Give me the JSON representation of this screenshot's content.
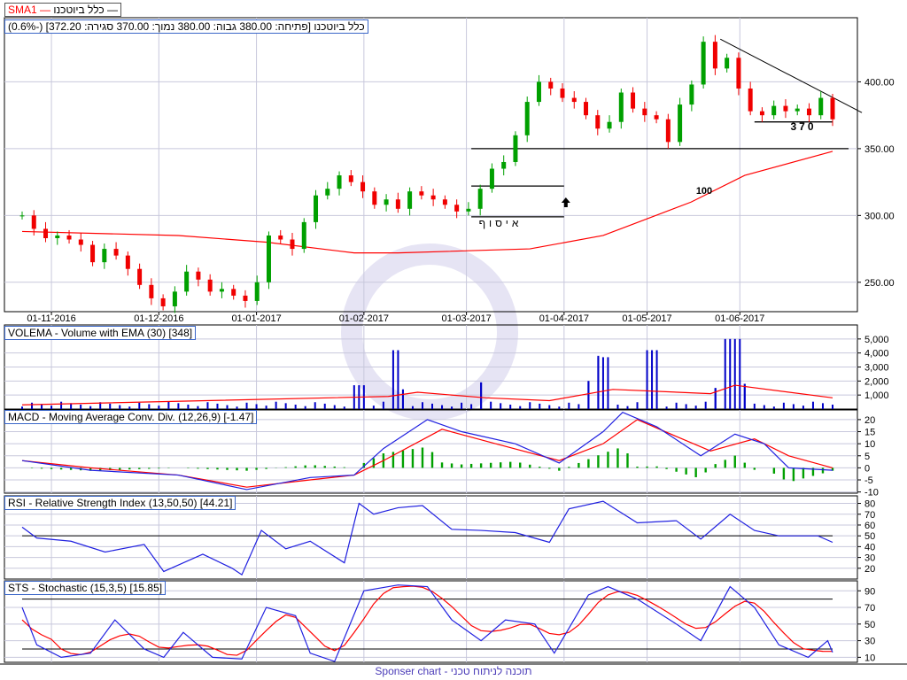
{
  "top_legend": {
    "series": "כלל ביוטכנו",
    "sma": "SMA1",
    "sma_color": "#ff0000"
  },
  "price_info": "כלל ביוטכנו [פתיחה: 380.00  גבוה: 380.00  נמוך: 370.00  סגירה: 372.20] (-0.6%)",
  "footer": "Sponser chart - תוכנה לניתוח טכני",
  "annotations": {
    "accumulation": "איסוף",
    "support": "370",
    "sma_label": "100"
  },
  "chart_data": [
    {
      "type": "candlestick",
      "title": "כלל ביוטכנו",
      "x_tick_labels": [
        "01-11-2016",
        "01-12-2016",
        "01-01-2017",
        "01-02-2017",
        "01-03-2017",
        "01-04-2017",
        "01-05-2017",
        "01-06-2017"
      ],
      "x_tick_days": [
        6,
        28,
        48,
        70,
        91,
        111,
        128,
        147
      ],
      "y_ticks": [
        250,
        300,
        350,
        400
      ],
      "y_tick_labels": [
        "250.00",
        "300.00",
        "350.00",
        "400.00"
      ],
      "ylim": [
        228,
        448
      ],
      "day_range": [
        0,
        166
      ],
      "closes": [
        300,
        290,
        283,
        285,
        282,
        278,
        265,
        275,
        270,
        260,
        248,
        238,
        232,
        243,
        258,
        252,
        243,
        245,
        240,
        236,
        250,
        285,
        282,
        275,
        295,
        315,
        320,
        330,
        325,
        318,
        308,
        312,
        305,
        318,
        315,
        312,
        308,
        303,
        305,
        320,
        335,
        340,
        360,
        385,
        400,
        395,
        388,
        385,
        375,
        365,
        370,
        392,
        380,
        375,
        372,
        355,
        383,
        398,
        430,
        410,
        418,
        395,
        378,
        375,
        382,
        378,
        380,
        375,
        388,
        372
      ],
      "sma": {
        "name": "SMA1 (100)",
        "color": "#ff0000",
        "points": [
          [
            0,
            288
          ],
          [
            32,
            285
          ],
          [
            50,
            280
          ],
          [
            68,
            272
          ],
          [
            77,
            272
          ],
          [
            104,
            275
          ],
          [
            119,
            285
          ],
          [
            137,
            310
          ],
          [
            148,
            330
          ],
          [
            166,
            348
          ]
        ]
      },
      "horizontal_lines": [
        {
          "value": 350,
          "from": 92,
          "to": 170
        },
        {
          "value": 322,
          "from": 92,
          "to": 111
        },
        {
          "value": 299,
          "from": 92,
          "to": 111
        },
        {
          "value": 370,
          "from": 150,
          "to": 166
        }
      ],
      "trendline": [
        [
          143,
          432
        ],
        [
          172,
          377
        ]
      ]
    },
    {
      "type": "bar",
      "title": "VOLEMA - Volume with EMA (30) [348]",
      "y_ticks": [
        1000,
        2000,
        3000,
        4000,
        5000
      ],
      "y_tick_labels": [
        "1,000",
        "2,000",
        "3,000",
        "4,000",
        "5,000"
      ],
      "ylim": [
        0,
        6000
      ],
      "spikes": [
        [
          69,
          1700
        ],
        [
          77,
          4200
        ],
        [
          78,
          1400
        ],
        [
          94,
          1900
        ],
        [
          116,
          2000
        ],
        [
          118,
          3800
        ],
        [
          119,
          3700
        ],
        [
          129,
          4200
        ],
        [
          142,
          1500
        ],
        [
          145,
          5000
        ],
        [
          147,
          5000
        ],
        [
          148,
          1800
        ]
      ],
      "base_volume": 350,
      "ema": {
        "color": "#ff0000",
        "points": [
          [
            0,
            300
          ],
          [
            75,
            900
          ],
          [
            81,
            1200
          ],
          [
            95,
            800
          ],
          [
            108,
            600
          ],
          [
            121,
            1400
          ],
          [
            141,
            1100
          ],
          [
            146,
            1700
          ],
          [
            166,
            800
          ]
        ]
      }
    },
    {
      "type": "line",
      "title": "MACD - Moving Average Conv. Div. (12,26,9) [-1.47]",
      "y_ticks": [
        -10,
        -5,
        0,
        5,
        10,
        15,
        20
      ],
      "ylim": [
        -10.5,
        24
      ],
      "macd": [
        [
          0,
          3
        ],
        [
          14,
          -1
        ],
        [
          32,
          -3
        ],
        [
          46,
          -9
        ],
        [
          59,
          -4
        ],
        [
          68,
          -3
        ],
        [
          74,
          8
        ],
        [
          83,
          20
        ],
        [
          90,
          15
        ],
        [
          101,
          10
        ],
        [
          110,
          2
        ],
        [
          119,
          15
        ],
        [
          123,
          23
        ],
        [
          130,
          17
        ],
        [
          139,
          5
        ],
        [
          146,
          14
        ],
        [
          152,
          10
        ],
        [
          157,
          0
        ],
        [
          166,
          -1
        ]
      ],
      "signal": [
        [
          0,
          3
        ],
        [
          14,
          0
        ],
        [
          32,
          -3
        ],
        [
          46,
          -8
        ],
        [
          59,
          -5
        ],
        [
          68,
          -3
        ],
        [
          74,
          3
        ],
        [
          86,
          16
        ],
        [
          97,
          10
        ],
        [
          110,
          3
        ],
        [
          119,
          10
        ],
        [
          126,
          20
        ],
        [
          134,
          13
        ],
        [
          141,
          7
        ],
        [
          150,
          12
        ],
        [
          157,
          5
        ],
        [
          166,
          0
        ]
      ]
    },
    {
      "type": "line",
      "title": "RSI - Relative Strength Index (13,50,50) [44.21]",
      "y_ticks": [
        20,
        30,
        40,
        50,
        60,
        70,
        80
      ],
      "ylim": [
        10,
        87
      ],
      "reference": 50,
      "values": [
        [
          0,
          58
        ],
        [
          3,
          48
        ],
        [
          10,
          45
        ],
        [
          17,
          35
        ],
        [
          25,
          42
        ],
        [
          29,
          17
        ],
        [
          37,
          33
        ],
        [
          43,
          20
        ],
        [
          45,
          14
        ],
        [
          49,
          55
        ],
        [
          54,
          38
        ],
        [
          59,
          45
        ],
        [
          66,
          25
        ],
        [
          69,
          80
        ],
        [
          72,
          70
        ],
        [
          77,
          76
        ],
        [
          82,
          78
        ],
        [
          88,
          56
        ],
        [
          94,
          55
        ],
        [
          101,
          53
        ],
        [
          108,
          44
        ],
        [
          112,
          75
        ],
        [
          119,
          82
        ],
        [
          126,
          62
        ],
        [
          134,
          64
        ],
        [
          139,
          47
        ],
        [
          145,
          70
        ],
        [
          150,
          55
        ],
        [
          155,
          50
        ],
        [
          163,
          50
        ],
        [
          166,
          44
        ]
      ]
    },
    {
      "type": "line",
      "title": "STS - Stochastic (15,3,5) [15.85]",
      "y_ticks": [
        10,
        30,
        50,
        70,
        90
      ],
      "ylim": [
        4,
        102
      ],
      "references": [
        20,
        80
      ],
      "values": [
        [
          0,
          70
        ],
        [
          3,
          25
        ],
        [
          8,
          10
        ],
        [
          14,
          15
        ],
        [
          19,
          55
        ],
        [
          25,
          20
        ],
        [
          29,
          10
        ],
        [
          33,
          40
        ],
        [
          39,
          10
        ],
        [
          45,
          8
        ],
        [
          50,
          70
        ],
        [
          56,
          60
        ],
        [
          59,
          15
        ],
        [
          64,
          5
        ],
        [
          70,
          90
        ],
        [
          77,
          97
        ],
        [
          83,
          95
        ],
        [
          88,
          55
        ],
        [
          94,
          30
        ],
        [
          99,
          55
        ],
        [
          105,
          50
        ],
        [
          109,
          15
        ],
        [
          116,
          85
        ],
        [
          120,
          95
        ],
        [
          126,
          80
        ],
        [
          134,
          50
        ],
        [
          139,
          30
        ],
        [
          145,
          95
        ],
        [
          150,
          70
        ],
        [
          155,
          25
        ],
        [
          161,
          10
        ],
        [
          165,
          30
        ],
        [
          166,
          16
        ]
      ]
    }
  ]
}
